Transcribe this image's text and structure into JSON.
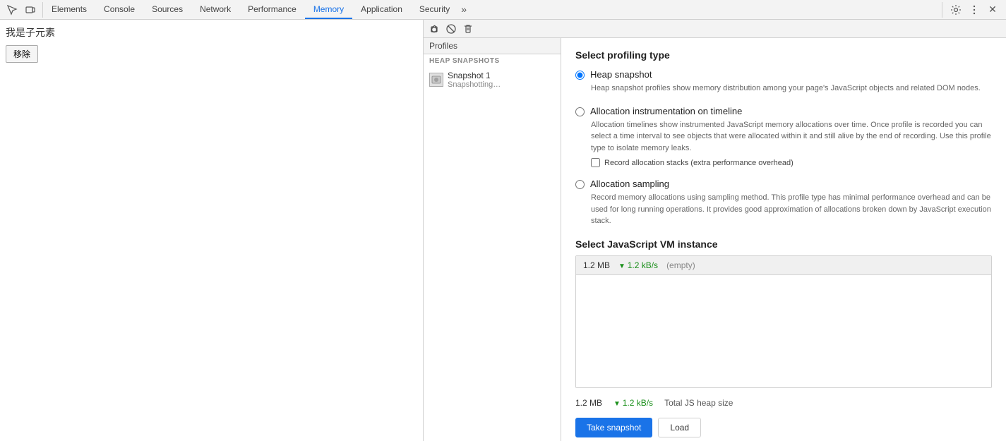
{
  "page": {
    "text": "我是子元素",
    "button": "移除"
  },
  "devtools": {
    "topbar": {
      "icons": [
        {
          "name": "inspect-icon",
          "symbol": "⬚"
        },
        {
          "name": "device-icon",
          "symbol": "▭"
        }
      ],
      "tabs": [
        {
          "id": "elements",
          "label": "Elements",
          "active": false
        },
        {
          "id": "console",
          "label": "Console",
          "active": false
        },
        {
          "id": "sources",
          "label": "Sources",
          "active": false
        },
        {
          "id": "network",
          "label": "Network",
          "active": false
        },
        {
          "id": "performance",
          "label": "Performance",
          "active": false
        },
        {
          "id": "memory",
          "label": "Memory",
          "active": true
        },
        {
          "id": "application",
          "label": "Application",
          "active": false
        },
        {
          "id": "security",
          "label": "Security",
          "active": false
        }
      ],
      "more_label": "»",
      "settings_icon": "⚙",
      "menu_icon": "⋮",
      "close_icon": "✕"
    },
    "toolbar": {
      "icons": [
        {
          "name": "record-icon",
          "symbol": "●",
          "title": "Take heap snapshot"
        },
        {
          "name": "clear-icon",
          "symbol": "🚫",
          "title": "Clear all profiles"
        },
        {
          "name": "delete-icon",
          "symbol": "🗑",
          "title": "Delete selected profile"
        }
      ]
    },
    "sidebar": {
      "tab_label": "Profiles",
      "section_label": "HEAP SNAPSHOTS",
      "items": [
        {
          "name": "Snapshot 1",
          "status": "Snapshotting…"
        }
      ]
    },
    "profiling": {
      "section_title": "Select profiling type",
      "options": [
        {
          "id": "heap-snapshot",
          "label": "Heap snapshot",
          "selected": true,
          "description": "Heap snapshot profiles show memory distribution among your page's JavaScript objects and related DOM nodes."
        },
        {
          "id": "allocation-timeline",
          "label": "Allocation instrumentation on timeline",
          "selected": false,
          "description": "Allocation timelines show instrumented JavaScript memory allocations over time. Once profile is recorded you can select a time interval to see objects that were allocated within it and still alive by the end of recording. Use this profile type to isolate memory leaks.",
          "sub_option": {
            "label": "Record allocation stacks (extra performance overhead)",
            "checked": false
          }
        },
        {
          "id": "allocation-sampling",
          "label": "Allocation sampling",
          "selected": false,
          "description": "Record memory allocations using sampling method. This profile type has minimal performance overhead and can be used for long running operations. It provides good approximation of allocations broken down by JavaScript execution stack."
        }
      ]
    },
    "vm": {
      "section_title": "Select JavaScript VM instance",
      "instance": {
        "size": "1.2 MB",
        "rate": "1.2 kB/s",
        "label": "(empty)"
      },
      "footer": {
        "size": "1.2 MB",
        "rate": "1.2 kB/s",
        "label": "Total JS heap size"
      }
    },
    "actions": {
      "snapshot_btn": "Take snapshot",
      "load_btn": "Load"
    }
  }
}
